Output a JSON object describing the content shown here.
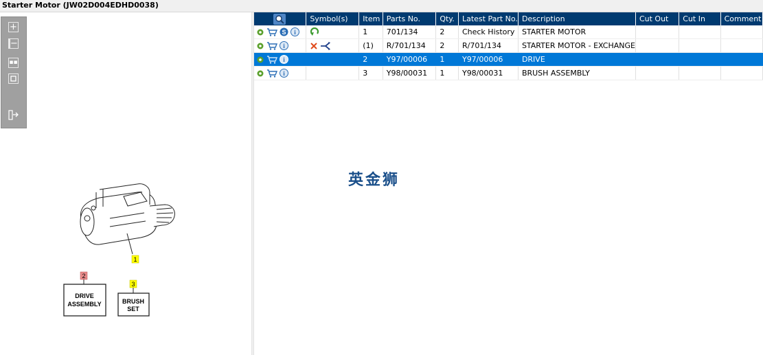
{
  "window": {
    "title": "Starter Motor (JW02D004EDHD0038)"
  },
  "toolbar": {
    "tools": [
      "zoom-in-icon",
      "zoom-out-icon",
      "fit-all-icon",
      "actual-size-icon",
      "export-icon"
    ]
  },
  "diagram": {
    "callouts": [
      "1",
      "2",
      "3"
    ],
    "drive_box": [
      "DRIVE",
      "ASSEMBLY"
    ],
    "brush_box": [
      "BRUSH",
      "SET"
    ]
  },
  "table": {
    "headers": [
      "",
      "Symbol(s)",
      "Item",
      "Parts No.",
      "Qty.",
      "Latest Part No.",
      "Description",
      "Cut Out",
      "Cut In",
      "Comment"
    ],
    "rows": [
      {
        "item": "1",
        "part_no": "701/134",
        "qty": "2",
        "latest": "Check History",
        "desc": "STARTER MOTOR",
        "cut_out": "",
        "cut_in": "",
        "comment": "",
        "selected": false
      },
      {
        "item": "(1)",
        "part_no": "R/701/134",
        "qty": "2",
        "latest": "R/701/134",
        "desc": "STARTER MOTOR - EXCHANGE",
        "cut_out": "",
        "cut_in": "",
        "comment": "",
        "selected": false
      },
      {
        "item": "2",
        "part_no": "Y97/00006",
        "qty": "1",
        "latest": "Y97/00006",
        "desc": "DRIVE",
        "cut_out": "",
        "cut_in": "",
        "comment": "",
        "selected": true
      },
      {
        "item": "3",
        "part_no": "Y98/00031",
        "qty": "1",
        "latest": "Y98/00031",
        "desc": "BRUSH ASSEMBLY",
        "cut_out": "",
        "cut_in": "",
        "comment": "",
        "selected": false
      }
    ]
  },
  "watermark": "英金狮",
  "colors": {
    "header_bg": "#003a70",
    "selected_row": "#0078d7",
    "callout_yellow": "#ffff00",
    "callout_red": "#e88a8a"
  }
}
